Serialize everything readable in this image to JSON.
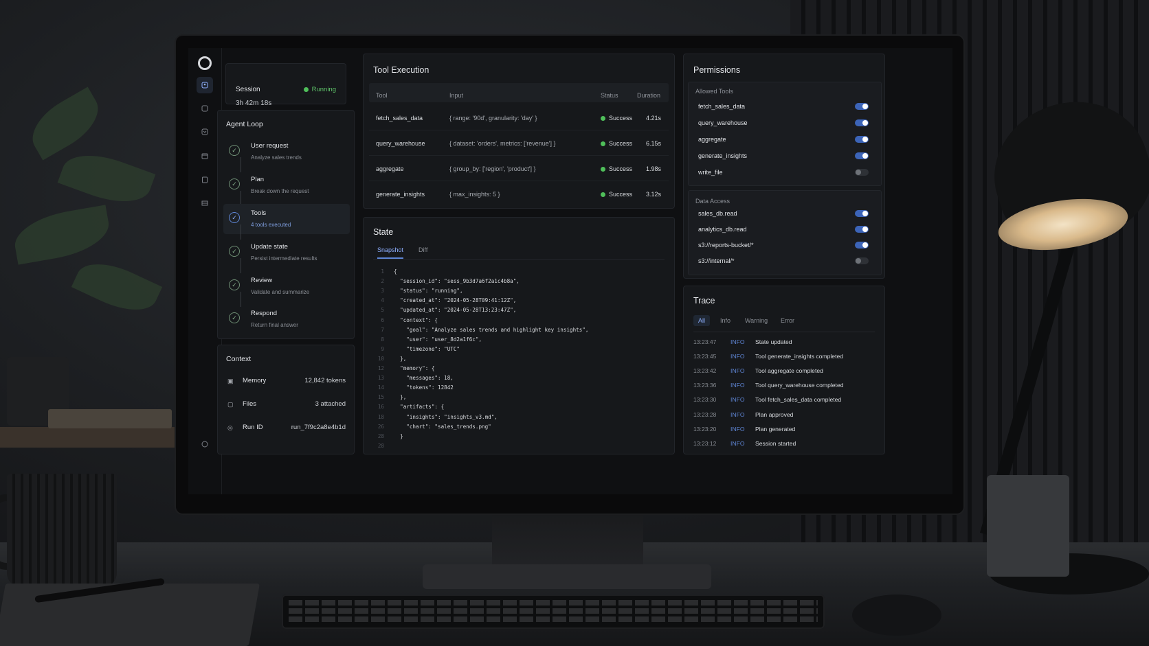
{
  "session": {
    "label": "Session",
    "status": "Running",
    "elapsed": "3h 42m 18s"
  },
  "agent_loop": {
    "title": "Agent Loop",
    "steps": [
      {
        "title": "User request",
        "subtitle": "Analyze sales trends"
      },
      {
        "title": "Plan",
        "subtitle": "Break down the request"
      },
      {
        "title": "Tools",
        "subtitle": "4 tools executed"
      },
      {
        "title": "Update state",
        "subtitle": "Persist intermediate results"
      },
      {
        "title": "Review",
        "subtitle": "Validate and summarize"
      },
      {
        "title": "Respond",
        "subtitle": "Return final answer"
      }
    ]
  },
  "context": {
    "title": "Context",
    "rows": [
      {
        "label": "Memory",
        "value": "12,842 tokens",
        "icon": "memory-icon"
      },
      {
        "label": "Files",
        "value": "3 attached",
        "icon": "file-icon"
      },
      {
        "label": "Run ID",
        "value": "run_7f9c2a8e4b1d",
        "icon": "run-id-icon"
      }
    ]
  },
  "tool_execution": {
    "title": "Tool Execution",
    "columns": [
      "Tool",
      "Input",
      "Status",
      "Duration"
    ],
    "rows": [
      {
        "tool": "fetch_sales_data",
        "input": "{ range: '90d', granularity: 'day' }",
        "status": "Success",
        "duration": "4.21s"
      },
      {
        "tool": "query_warehouse",
        "input": "{ dataset: 'orders', metrics: ['revenue'] }",
        "status": "Success",
        "duration": "6.15s"
      },
      {
        "tool": "aggregate",
        "input": "{ group_by: ['region', 'product'] }",
        "status": "Success",
        "duration": "1.98s"
      },
      {
        "tool": "generate_insights",
        "input": "{ max_insights: 5 }",
        "status": "Success",
        "duration": "3.12s"
      }
    ]
  },
  "state": {
    "title": "State",
    "tabs": [
      "Snapshot",
      "Diff"
    ],
    "active_tab": "Snapshot",
    "code": [
      {
        "n": "1",
        "text": "{"
      },
      {
        "n": "2",
        "text": "  \"session_id\": \"sess_9b3d7a6f2a1c4b8a\","
      },
      {
        "n": "3",
        "text": "  \"status\": \"running\","
      },
      {
        "n": "4",
        "text": "  \"created_at\": \"2024-05-28T09:41:12Z\","
      },
      {
        "n": "5",
        "text": "  \"updated_at\": \"2024-05-28T13:23:47Z\","
      },
      {
        "n": "6",
        "text": "  \"context\": {"
      },
      {
        "n": "7",
        "text": "    \"goal\": \"Analyze sales trends and highlight key insights\","
      },
      {
        "n": "8",
        "text": "    \"user\": \"user_8d2a1f6c\","
      },
      {
        "n": "9",
        "text": "    \"timezone\": \"UTC\""
      },
      {
        "n": "10",
        "text": "  },"
      },
      {
        "n": "12",
        "text": "  \"memory\": {"
      },
      {
        "n": "13",
        "text": "    \"messages\": 18,"
      },
      {
        "n": "14",
        "text": "    \"tokens\": 12842"
      },
      {
        "n": "15",
        "text": "  },"
      },
      {
        "n": "16",
        "text": "  \"artifacts\": {"
      },
      {
        "n": "18",
        "text": "    \"insights\": \"insights_v3.md\","
      },
      {
        "n": "26",
        "text": "    \"chart\": \"sales_trends.png\""
      },
      {
        "n": "28",
        "text": "  }"
      },
      {
        "n": "28",
        "text": ""
      }
    ]
  },
  "permissions": {
    "title": "Permissions",
    "allowed_tools_title": "Allowed Tools",
    "allowed_tools": [
      {
        "name": "fetch_sales_data",
        "enabled": true
      },
      {
        "name": "query_warehouse",
        "enabled": true
      },
      {
        "name": "aggregate",
        "enabled": true
      },
      {
        "name": "generate_insights",
        "enabled": true
      },
      {
        "name": "write_file",
        "enabled": false
      }
    ],
    "data_access_title": "Data Access",
    "data_access": [
      {
        "name": "sales_db.read",
        "enabled": true
      },
      {
        "name": "analytics_db.read",
        "enabled": true
      },
      {
        "name": "s3://reports-bucket/*",
        "enabled": true
      },
      {
        "name": "s3://internal/*",
        "enabled": false
      }
    ]
  },
  "trace": {
    "title": "Trace",
    "tabs": [
      "All",
      "Info",
      "Warning",
      "Error"
    ],
    "active_tab": "All",
    "entries": [
      {
        "time": "13:23:47",
        "level": "INFO",
        "message": "State updated"
      },
      {
        "time": "13:23:45",
        "level": "INFO",
        "message": "Tool generate_insights completed"
      },
      {
        "time": "13:23:42",
        "level": "INFO",
        "message": "Tool aggregate completed"
      },
      {
        "time": "13:23:36",
        "level": "INFO",
        "message": "Tool query_warehouse completed"
      },
      {
        "time": "13:23:30",
        "level": "INFO",
        "message": "Tool fetch_sales_data completed"
      },
      {
        "time": "13:23:28",
        "level": "INFO",
        "message": "Plan approved"
      },
      {
        "time": "13:23:20",
        "level": "INFO",
        "message": "Plan generated"
      },
      {
        "time": "13:23:12",
        "level": "INFO",
        "message": "Session started"
      }
    ]
  },
  "rail_icons": [
    "app-logo-icon",
    "agent-icon",
    "chat-icon",
    "tools-icon",
    "calendar-icon",
    "document-icon",
    "server-icon",
    "help-icon"
  ],
  "colors": {
    "accent": "#5f86d6",
    "success": "#4fbf5a",
    "background": "#0f1012",
    "card": "#16181b"
  }
}
